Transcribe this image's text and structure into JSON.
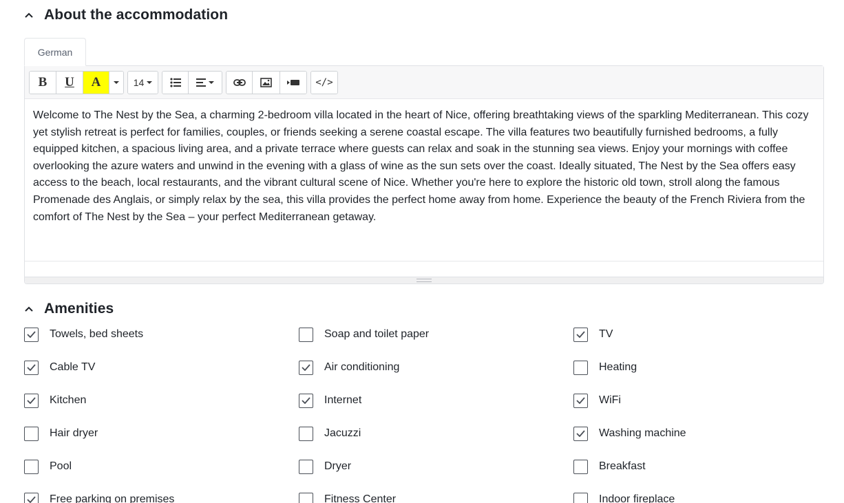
{
  "about": {
    "title": "About the accommodation",
    "tab_label": "German",
    "font_size": "14",
    "code_label": "</>",
    "description": "Welcome to The Nest by the Sea, a charming 2-bedroom villa located in the heart of Nice, offering breathtaking views of the sparkling Mediterranean. This cozy yet stylish retreat is perfect for families, couples, or friends seeking a serene coastal escape. The villa features two beautifully furnished bedrooms, a fully equipped kitchen, a spacious living area, and a private terrace where guests can relax and soak in the stunning sea views. Enjoy your mornings with coffee overlooking the azure waters and unwind in the evening with a glass of wine as the sun sets over the coast. Ideally situated, The Nest by the Sea offers easy access to the beach, local restaurants, and the vibrant cultural scene of Nice. Whether you're here to explore the historic old town, stroll along the famous Promenade des Anglais, or simply relax by the sea, this villa provides the perfect home away from home. Experience the beauty of the French Riviera from the comfort of The Nest by the Sea – your perfect Mediterranean getaway."
  },
  "toolbar": {
    "bold": "B",
    "underline": "U",
    "highlight": "A",
    "highlight_color": "#ffff00"
  },
  "amenities": {
    "title": "Amenities",
    "items": [
      {
        "label": "Towels, bed sheets",
        "checked": true
      },
      {
        "label": "Soap and toilet paper",
        "checked": false
      },
      {
        "label": "TV",
        "checked": true
      },
      {
        "label": "Cable TV",
        "checked": true
      },
      {
        "label": "Air conditioning",
        "checked": true
      },
      {
        "label": "Heating",
        "checked": false
      },
      {
        "label": "Kitchen",
        "checked": true
      },
      {
        "label": "Internet",
        "checked": true
      },
      {
        "label": "WiFi",
        "checked": true
      },
      {
        "label": "Hair dryer",
        "checked": false
      },
      {
        "label": "Jacuzzi",
        "checked": false
      },
      {
        "label": "Washing machine",
        "checked": true
      },
      {
        "label": "Pool",
        "checked": false
      },
      {
        "label": "Dryer",
        "checked": false
      },
      {
        "label": "Breakfast",
        "checked": false
      },
      {
        "label": "Free parking on premises",
        "checked": true
      },
      {
        "label": "Fitness Center",
        "checked": false
      },
      {
        "label": "Indoor fireplace",
        "checked": false
      }
    ]
  }
}
